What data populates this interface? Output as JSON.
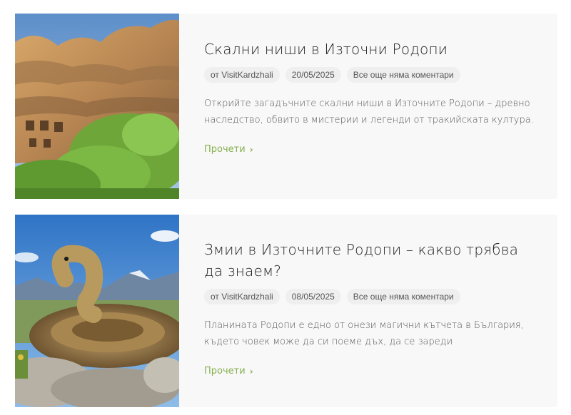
{
  "posts": [
    {
      "title": "Скални ниши в Източни Родопи",
      "author": "от VisitKardzhali",
      "date": "20/05/2025",
      "comments": "Все още няма коментари",
      "excerpt": "Открийте загадъчните скални ниши в Източните Родопи – древно наследство, обвито в мистерии и легенди от тракийската култура.",
      "read_more": "Прочети"
    },
    {
      "title": "Змии в Източните Родопи – какво трябва да знаем?",
      "author": "от VisitKardzhali",
      "date": "08/05/2025",
      "comments": "Все още няма коментари",
      "excerpt": "Планината Родопи е едно от онези магични кътчета в България, където човек може да си поеме дъх, да се зареди",
      "read_more": "Прочети"
    }
  ],
  "icons": {
    "read_more": "chevron-right-icon"
  },
  "colors": {
    "accent": "#86b04f",
    "card_bg": "#f8f8f8",
    "pill_bg": "#efefef"
  }
}
